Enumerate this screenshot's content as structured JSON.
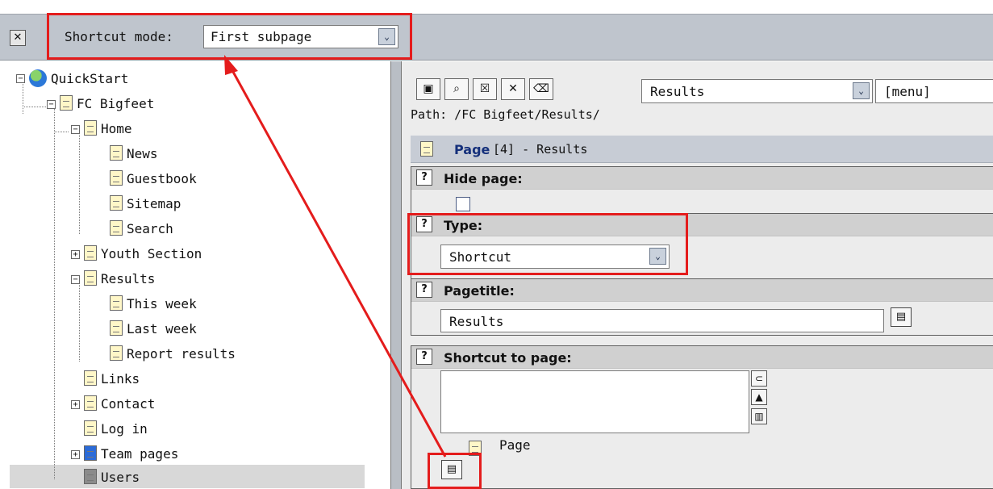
{
  "topbar": {
    "close_icon": "✕",
    "shortcut_mode_label": "Shortcut mode:",
    "shortcut_mode_value": "First subpage",
    "dropdown_arrow": "⌄"
  },
  "tree": {
    "items": [
      {
        "label": "QuickStart",
        "icon": "globe-icon"
      },
      {
        "label": "FC Bigfeet",
        "icon": "page-icon"
      },
      {
        "label": "Home",
        "icon": "shortcut-page-icon"
      },
      {
        "label": "News",
        "icon": "page-icon"
      },
      {
        "label": "Guestbook",
        "icon": "page-icon"
      },
      {
        "label": "Sitemap",
        "icon": "page-icon"
      },
      {
        "label": "Search",
        "icon": "page-icon"
      },
      {
        "label": "Youth Section",
        "icon": "page-icon"
      },
      {
        "label": "Results",
        "icon": "shortcut-page-icon"
      },
      {
        "label": "This week",
        "icon": "page-icon"
      },
      {
        "label": "Last week",
        "icon": "page-icon"
      },
      {
        "label": "Report results",
        "icon": "page-icon"
      },
      {
        "label": "Links",
        "icon": "page-icon"
      },
      {
        "label": "Contact",
        "icon": "page-icon"
      },
      {
        "label": "Log in",
        "icon": "page-icon"
      },
      {
        "label": "Team pages",
        "icon": "team-pages-icon"
      },
      {
        "label": "Users",
        "icon": "folder-icon"
      }
    ]
  },
  "toolbar": {
    "buttons": [
      {
        "name": "save-icon",
        "glyph": "▣"
      },
      {
        "name": "save-view-icon",
        "glyph": "⌕"
      },
      {
        "name": "save-close-icon",
        "glyph": "☒"
      },
      {
        "name": "close-icon",
        "glyph": "✕"
      },
      {
        "name": "delete-icon",
        "glyph": "⌫"
      }
    ],
    "page_select": "Results",
    "menu_select": "[menu]"
  },
  "path": {
    "text": "Path: /FC Bigfeet/Results/"
  },
  "page_header": {
    "label": "Page",
    "rest": "[4] - Results"
  },
  "fields": {
    "hide_page": "Hide page:",
    "type": "Type:",
    "type_value": "Shortcut",
    "pagetitle": "Pagetitle:",
    "pagetitle_value": "Results",
    "shortcut_to_page": "Shortcut to page:",
    "shortcut_page_label": "Page"
  },
  "colors": {
    "annotation_red": "#e41c1c",
    "header_blue": "#15307b",
    "panel_gray": "#ececec"
  }
}
